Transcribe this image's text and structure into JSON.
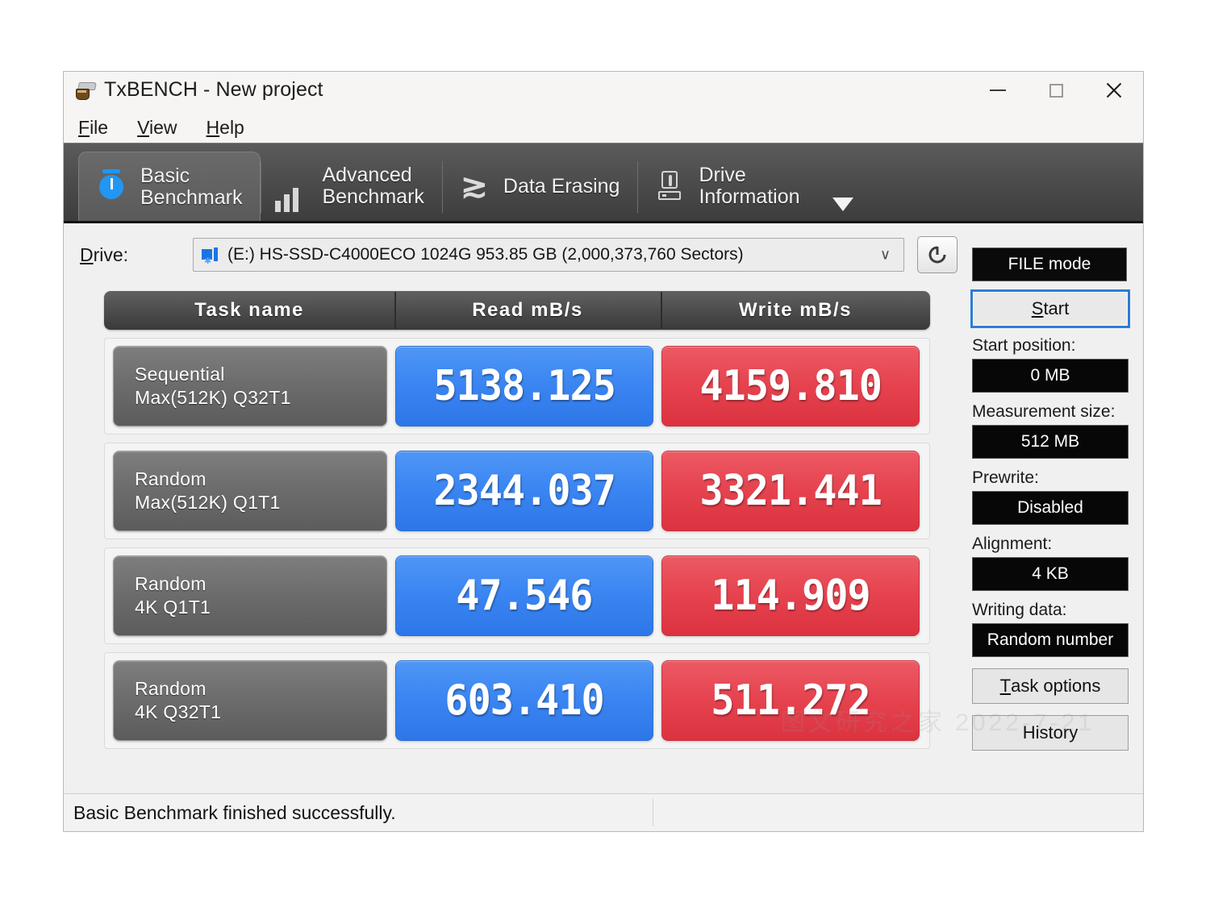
{
  "window": {
    "title": "TxBENCH - New project",
    "icon": "app-icon",
    "controls": {
      "minimize": "minimize-icon",
      "maximize": "maximize-icon",
      "close": "close-icon"
    }
  },
  "menubar": {
    "items": [
      {
        "pre": "F",
        "rest": "ile"
      },
      {
        "pre": "V",
        "rest": "iew"
      },
      {
        "pre": "H",
        "rest": "elp"
      }
    ]
  },
  "toolbar": {
    "tabs": [
      {
        "label": "Basic\nBenchmark",
        "icon": "stopwatch-icon",
        "active": true
      },
      {
        "label": "Advanced\nBenchmark",
        "icon": "bar-chart-icon",
        "active": false
      },
      {
        "label": "Data Erasing",
        "icon": "zigzag-icon",
        "active": false
      },
      {
        "label": "Drive\nInformation",
        "icon": "drive-icon",
        "active": false
      }
    ],
    "overflow": "chevron-down-icon"
  },
  "drive": {
    "label_pre": "D",
    "label_rest": "rive:",
    "selected": "(E:) HS-SSD-C4000ECO 1024G  953.85 GB (2,000,373,760 Sectors)",
    "caret": "∨",
    "refresh": "refresh-icon",
    "mode_button": "FILE mode"
  },
  "results": {
    "columns": [
      "Task name",
      "Read mB/s",
      "Write mB/s"
    ],
    "rows": [
      {
        "name_line1": "Sequential",
        "name_line2": "Max(512K) Q32T1",
        "read": "5138.125",
        "write": "4159.810"
      },
      {
        "name_line1": "Random",
        "name_line2": "Max(512K) Q1T1",
        "read": "2344.037",
        "write": "3321.441"
      },
      {
        "name_line1": "Random",
        "name_line2": "4K Q1T1",
        "read": "47.546",
        "write": "114.909"
      },
      {
        "name_line1": "Random",
        "name_line2": "4K Q32T1",
        "read": "603.410",
        "write": "511.272"
      }
    ]
  },
  "side": {
    "start_pre": "S",
    "start_rest": "tart",
    "fields": [
      {
        "label": "Start position:",
        "value": "0 MB"
      },
      {
        "label": "Measurement size:",
        "value": "512 MB"
      },
      {
        "label": "Prewrite:",
        "value": "Disabled"
      },
      {
        "label": "Alignment:",
        "value": "4 KB"
      },
      {
        "label": "Writing data:",
        "value": "Random number"
      }
    ],
    "task_options_pre": "T",
    "task_options_rest": "ask options",
    "history": "History"
  },
  "status": {
    "message": "Basic Benchmark finished successfully."
  },
  "watermark": {
    "text": "图文研究之家 2022-7-21"
  },
  "colors": {
    "read_tile": "#3b86f2",
    "write_tile": "#e64450",
    "toolbar_dark": "#4a4a4a",
    "focus_blue": "#2c7cd6",
    "value_black": "#070707"
  }
}
